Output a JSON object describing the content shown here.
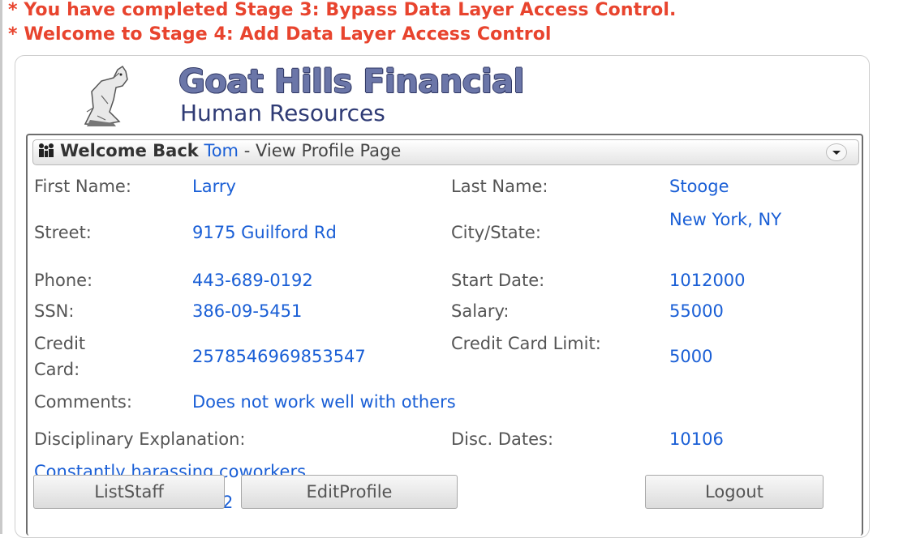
{
  "messages": {
    "completed": "* You have completed Stage 3: Bypass Data Layer Access Control.",
    "welcome": "* Welcome to Stage 4: Add Data Layer Access Control"
  },
  "logo": {
    "title": "Goat Hills Financial",
    "subtitle": "Human Resources"
  },
  "header": {
    "welcome_text": "Welcome Back",
    "user_name": "Tom",
    "page_text": "- View Profile Page",
    "icon": "people-icon",
    "collapse_icon": "chevron-down-icon"
  },
  "profile": {
    "first_name_label": "First Name:",
    "first_name": "Larry",
    "last_name_label": "Last Name:",
    "last_name": "Stooge",
    "street_label": "Street:",
    "street": "9175 Guilford Rd",
    "city_state_label": "City/State:",
    "city_state": "New York, NY",
    "phone_label": "Phone:",
    "phone": "443-689-0192",
    "start_date_label": "Start Date:",
    "start_date": "1012000",
    "ssn_label": "SSN:",
    "ssn": "386-09-5451",
    "salary_label": "Salary:",
    "salary": "55000",
    "credit_card_label": "Credit Card:",
    "credit_card": "2578546969853547",
    "credit_limit_label": "Credit Card Limit:",
    "credit_limit": "5000",
    "comments_label": "Comments:",
    "comments": "Does not work well with others",
    "disciplinary_label": "Disciplinary Explanation:",
    "disc_dates_label": "Disc. Dates:",
    "disc_dates": "10106",
    "disciplinary_explanation": "Constantly harassing coworkers",
    "partial_hidden_text": "2"
  },
  "buttons": {
    "list_staff": "ListStaff",
    "edit_profile": "EditProfile",
    "logout": "Logout"
  },
  "colors": {
    "message": "#e8442e",
    "value": "#1a5fd6",
    "label": "#555555"
  }
}
